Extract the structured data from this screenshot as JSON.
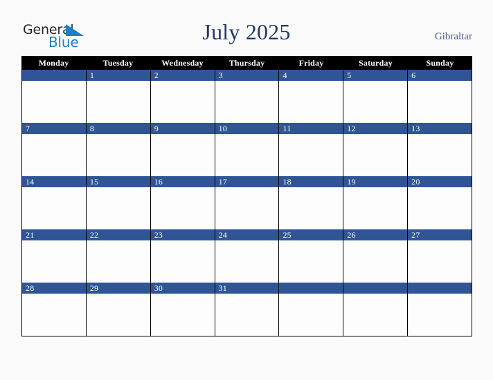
{
  "logo": {
    "text_top": "General",
    "text_bottom": "Blue",
    "triangle_color": "#1b7fc4",
    "top_color": "#262626",
    "bottom_color": "#1b7fc4"
  },
  "header": {
    "title": "July 2025",
    "country": "Gibraltar",
    "title_color": "#24395f",
    "country_color": "#4a5f87"
  },
  "calendar": {
    "weekday_headers": [
      "Monday",
      "Tuesday",
      "Wednesday",
      "Thursday",
      "Friday",
      "Saturday",
      "Sunday"
    ],
    "header_bg": "#000000",
    "header_text_color": "#ffffff",
    "daybar_bg": "#2f5597",
    "daybar_text_color": "#ffffff",
    "cell_bg": "#fdfdfd",
    "grid_line_color": "#000000",
    "weeks": [
      {
        "days": [
          "",
          "1",
          "2",
          "3",
          "4",
          "5",
          "6"
        ]
      },
      {
        "days": [
          "7",
          "8",
          "9",
          "10",
          "11",
          "12",
          "13"
        ]
      },
      {
        "days": [
          "14",
          "15",
          "16",
          "17",
          "18",
          "19",
          "20"
        ]
      },
      {
        "days": [
          "21",
          "22",
          "23",
          "24",
          "25",
          "26",
          "27"
        ]
      },
      {
        "days": [
          "28",
          "29",
          "30",
          "31",
          "",
          "",
          ""
        ]
      }
    ]
  },
  "page": {
    "background": "#fafafa"
  }
}
